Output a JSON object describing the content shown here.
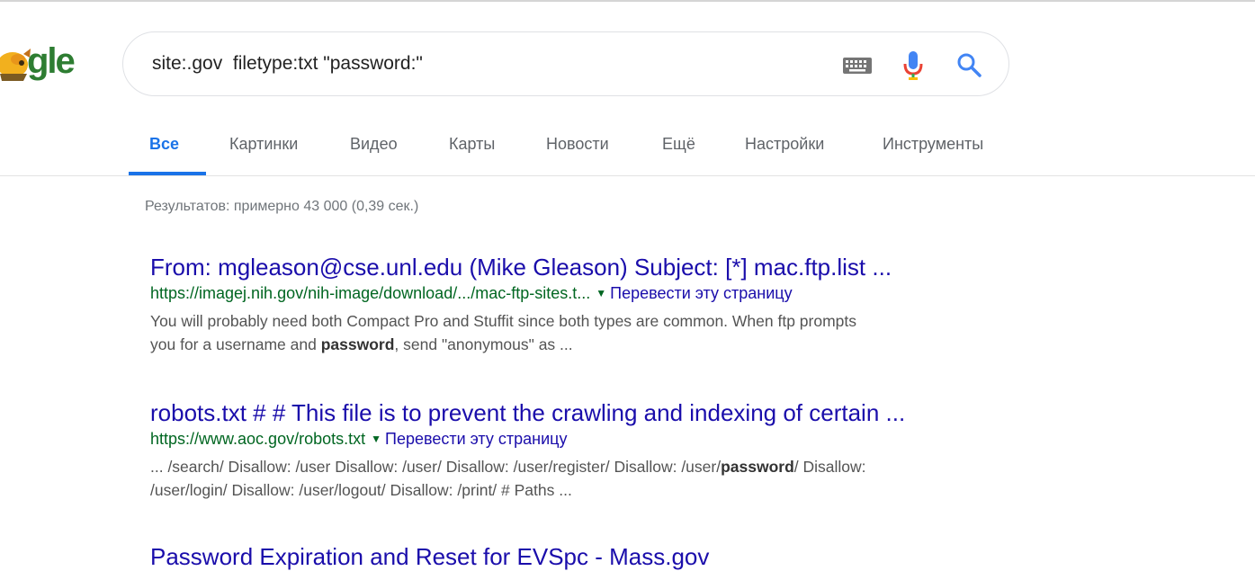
{
  "logo": {
    "text": "gle",
    "icon": "google-doodle-logo"
  },
  "search": {
    "query": "site:.gov  filetype:txt \"password:\"",
    "keyboard_icon": "keyboard-icon",
    "mic_icon": "microphone-icon",
    "search_icon": "search-icon"
  },
  "tabs": [
    {
      "label": "Все",
      "active": true
    },
    {
      "label": "Картинки"
    },
    {
      "label": "Видео"
    },
    {
      "label": "Карты"
    },
    {
      "label": "Новости"
    },
    {
      "label": "Ещё"
    },
    {
      "label": "Настройки"
    },
    {
      "label": "Инструменты"
    }
  ],
  "result_stats": "Результатов: примерно 43 000 (0,39 сек.)",
  "results": [
    {
      "title": "From: mgleason@cse.unl.edu (Mike Gleason) Subject: [*] mac.ftp.list ...",
      "url": "https://imagej.nih.gov/nih-image/download/.../mac-ftp-sites.t...",
      "translate": "Перевести эту страницу",
      "snippet_1a": "You will probably need both Compact Pro and Stuffit since both types are common. When ftp prompts",
      "snippet_2a": "you for a username and ",
      "snippet_2b": "password",
      "snippet_2c": ", send \"anonymous\" as ..."
    },
    {
      "title": "robots.txt # # This file is to prevent the crawling and indexing of certain ...",
      "url": "https://www.aoc.gov/robots.txt",
      "translate": "Перевести эту страницу",
      "snippet_1a": "... /search/ Disallow: /user Disallow: /user/ Disallow: /user/register/ Disallow: /user/",
      "snippet_1b": "password",
      "snippet_1c": "/ Disallow:",
      "snippet_2a": "/user/login/ Disallow: /user/logout/ Disallow: /print/ # Paths ..."
    },
    {
      "title": "Password Expiration and Reset for EVSpc - Mass.gov"
    }
  ],
  "colors": {
    "link": "#1a0dab",
    "url": "#006621",
    "accent": "#1a73e8",
    "snippet": "#545454"
  }
}
